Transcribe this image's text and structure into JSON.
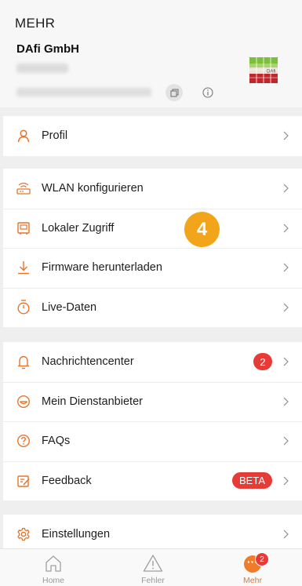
{
  "header": {
    "title": "MEHR",
    "company": "DAfi GmbH",
    "logo_text": "DAfi"
  },
  "groups": {
    "profile": [
      {
        "label": "Profil",
        "icon": "person-icon"
      }
    ],
    "device": [
      {
        "label": "WLAN konfigurieren",
        "icon": "router-icon"
      },
      {
        "label": "Lokaler Zugriff",
        "icon": "local-access-icon"
      },
      {
        "label": "Firmware herunterladen",
        "icon": "download-icon"
      },
      {
        "label": "Live-Daten",
        "icon": "stopwatch-icon"
      }
    ],
    "support": [
      {
        "label": "Nachrichtencenter",
        "icon": "bell-icon",
        "badge": "2"
      },
      {
        "label": "Mein Dienstanbieter",
        "icon": "service-provider-icon"
      },
      {
        "label": "FAQs",
        "icon": "question-icon"
      },
      {
        "label": "Feedback",
        "icon": "feedback-icon",
        "badge": "BETA"
      }
    ],
    "settings": [
      {
        "label": "Einstellungen",
        "icon": "gear-icon"
      }
    ]
  },
  "step_marker": "4",
  "tabbar": {
    "tabs": [
      {
        "label": "Home",
        "icon": "home-icon"
      },
      {
        "label": "Fehler",
        "icon": "warning-icon"
      },
      {
        "label": "Mehr",
        "icon": "more-icon",
        "badge": "2",
        "active": true
      }
    ]
  },
  "colors": {
    "accent": "#f07b2b",
    "icon_orange": "#e8742b",
    "badge_red": "#e63b37",
    "marker": "#f2a51a"
  }
}
